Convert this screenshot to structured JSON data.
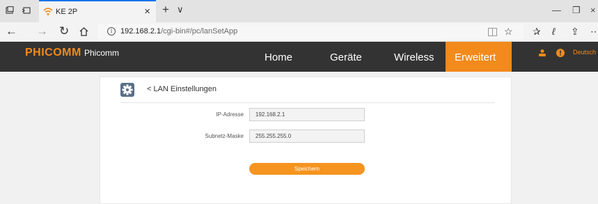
{
  "browser": {
    "tab_title": "KE 2P",
    "url_host": "192.168.2.1",
    "url_path": "/cgi-bin#/pc/lanSetApp"
  },
  "header": {
    "logo": "PHICOMM",
    "logo_sub": "Phicomm",
    "nav": [
      "Home",
      "Geräte",
      "Wireless",
      "Erweitert"
    ],
    "active_nav": "Erweitert",
    "language": "Deutsch",
    "accent_color": "#f28a1c"
  },
  "page": {
    "back_label": "< LAN Einstellungen",
    "ip_label": "IP-Adresse",
    "ip_value": "192.168.2.1",
    "mask_label": "Subnetz-Maske",
    "mask_value": "255.255.255.0",
    "save_label": "Speichern"
  }
}
